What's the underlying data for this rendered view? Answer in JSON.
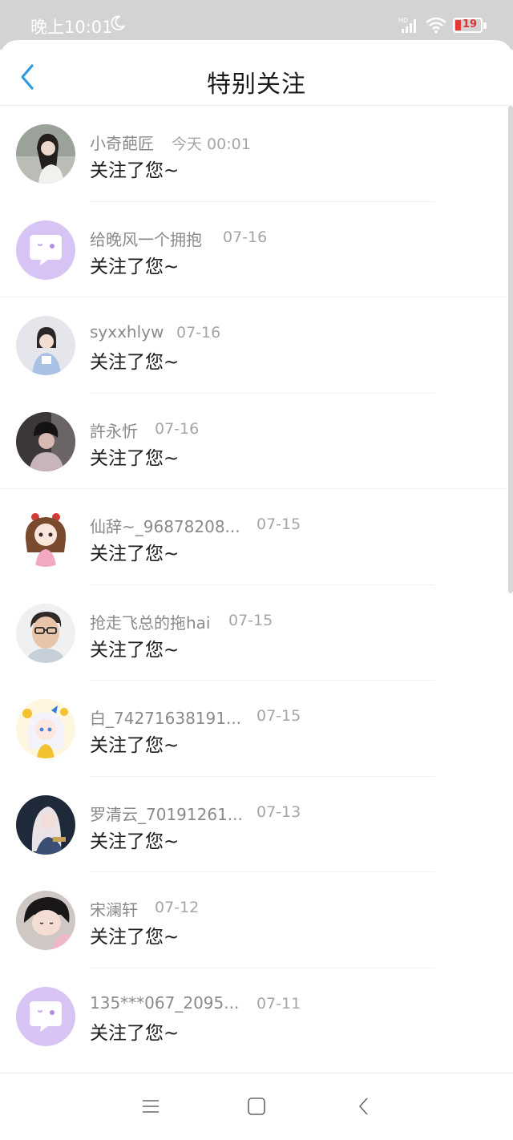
{
  "status_bar": {
    "time": "晚上10:01",
    "battery_level": "19",
    "icons": [
      "moon-icon",
      "hd-signal-icon",
      "wifi-icon",
      "battery-icon"
    ]
  },
  "header": {
    "title": "特别关注",
    "back_icon": "chevron-left-icon",
    "accent_color": "#2d9cdb"
  },
  "items": [
    {
      "name": "小奇葩匠",
      "time": "今天 00:01",
      "message": "关注了您~",
      "avatar": "photo"
    },
    {
      "name": "给晚风一个拥抱",
      "time": "07-16",
      "message": "关注了您~",
      "avatar": "default"
    },
    {
      "name": "syxxhlyw",
      "time": "07-16",
      "message": "关注了您~",
      "avatar": "photo"
    },
    {
      "name": "許永忻",
      "time": "07-16",
      "message": "关注了您~",
      "avatar": "photo"
    },
    {
      "name": "仙辞~_96878208...",
      "time": "07-15",
      "message": "关注了您~",
      "avatar": "anime"
    },
    {
      "name": "抢走飞总的拖hai",
      "time": "07-15",
      "message": "关注了您~",
      "avatar": "photo"
    },
    {
      "name": "白_74271638191...",
      "time": "07-15",
      "message": "关注了您~",
      "avatar": "anime"
    },
    {
      "name": "罗清云_70191261...",
      "time": "07-13",
      "message": "关注了您~",
      "avatar": "photo"
    },
    {
      "name": "宋澜轩",
      "time": "07-12",
      "message": "关注了您~",
      "avatar": "photo"
    },
    {
      "name": "135***067_2095...",
      "time": "07-11",
      "message": "关注了您~",
      "avatar": "default"
    }
  ],
  "nav_bar": {
    "icons": [
      "menu-icon",
      "home-square-icon",
      "back-triangle-icon"
    ]
  }
}
